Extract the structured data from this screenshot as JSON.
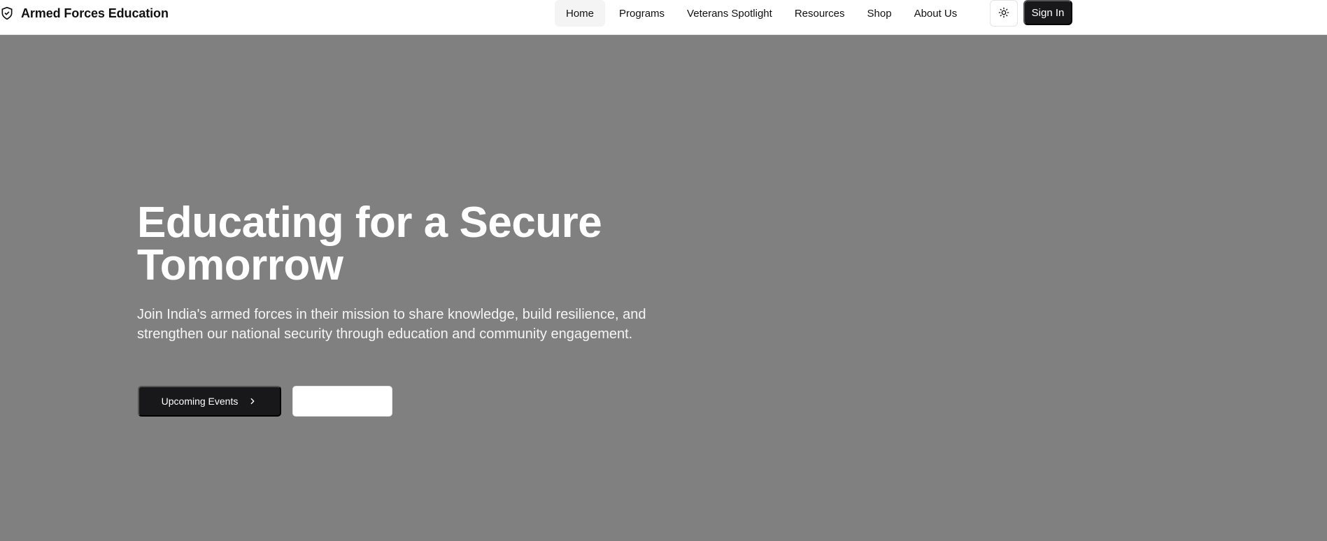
{
  "header": {
    "brand": "Armed Forces Education",
    "nav": [
      {
        "label": "Home",
        "active": true
      },
      {
        "label": "Programs"
      },
      {
        "label": "Veterans Spotlight"
      },
      {
        "label": "Resources"
      },
      {
        "label": "Shop"
      },
      {
        "label": "About Us"
      }
    ],
    "theme_icon": "sun-icon",
    "signin_label": "Sign In"
  },
  "hero": {
    "title": "Educating for a Secure Tomorrow",
    "subtitle": "Join India's armed forces in their mission to share knowledge, build resilience, and strengthen our national security through education and community engagement.",
    "primary_label": "Upcoming Events",
    "primary_icon": "chevron-right-icon",
    "secondary_label": ""
  },
  "colors": {
    "hero_bg": "#808080",
    "primary_button": "#18181b",
    "text_light": "#ffffff"
  }
}
